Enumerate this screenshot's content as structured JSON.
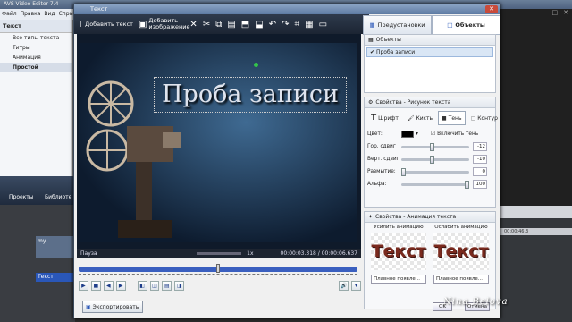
{
  "background_app": {
    "title": "AVS Video Editor 7.4",
    "menu": [
      "Файл",
      "Правка",
      "Вид",
      "Справка"
    ],
    "left_header": "Текст",
    "left_items": [
      "Все типы текста",
      "Титры",
      "Анимация",
      "Простой"
    ],
    "bottom_labels": [
      "Проекты",
      "Библиоте"
    ],
    "timeline_text_label": "Текст",
    "timeline_media_label": "my",
    "right_ruler": "00:00:46.3"
  },
  "dialog": {
    "title": "Текст",
    "toolbar": {
      "add_text": "Добавить текст",
      "add_image": "Добавить изображение"
    },
    "preview_text": "Проба записи",
    "status": {
      "state": "Пауза",
      "speed": "1x",
      "time": "00:00:03.318 / 00:00:06.637"
    },
    "tabs": {
      "presets": "Предустановки",
      "objects": "Объекты"
    },
    "objects_header": "Объекты",
    "object_item": "Проба записи",
    "props_header": "Свойства - Рисунок текста",
    "prop_tabs": [
      "Шрифт",
      "Кисть",
      "Тень",
      "Контур"
    ],
    "color_label": "Цвет:",
    "shadow_checkbox": "Включить тень",
    "rows": [
      {
        "label": "Гор. сдвиг",
        "value": "-12",
        "pos": 0.45
      },
      {
        "label": "Верт. сдвиг",
        "value": "-10",
        "pos": 0.45
      },
      {
        "label": "Размытие:",
        "value": "0",
        "pos": 0.0
      },
      {
        "label": "Альфа:",
        "value": "100",
        "pos": 1.0
      }
    ],
    "anim_header": "Свойства - Анимация текста",
    "anim_in_label": "Усилить анимацию",
    "anim_out_label": "Ослабить анимацию",
    "anim_preview_text": "Текст",
    "anim_in_select": "Плавное появле...",
    "anim_out_select": "Плавное появле...",
    "export_button": "Экспортировать",
    "ok_button": "OK",
    "cancel_button": "Отмена"
  },
  "watermark": "Nina Belova",
  "colors": {
    "accent": "#3a5fbf",
    "toolbar_dark": "#1c2533",
    "title_blue": "#5d7aa2"
  }
}
